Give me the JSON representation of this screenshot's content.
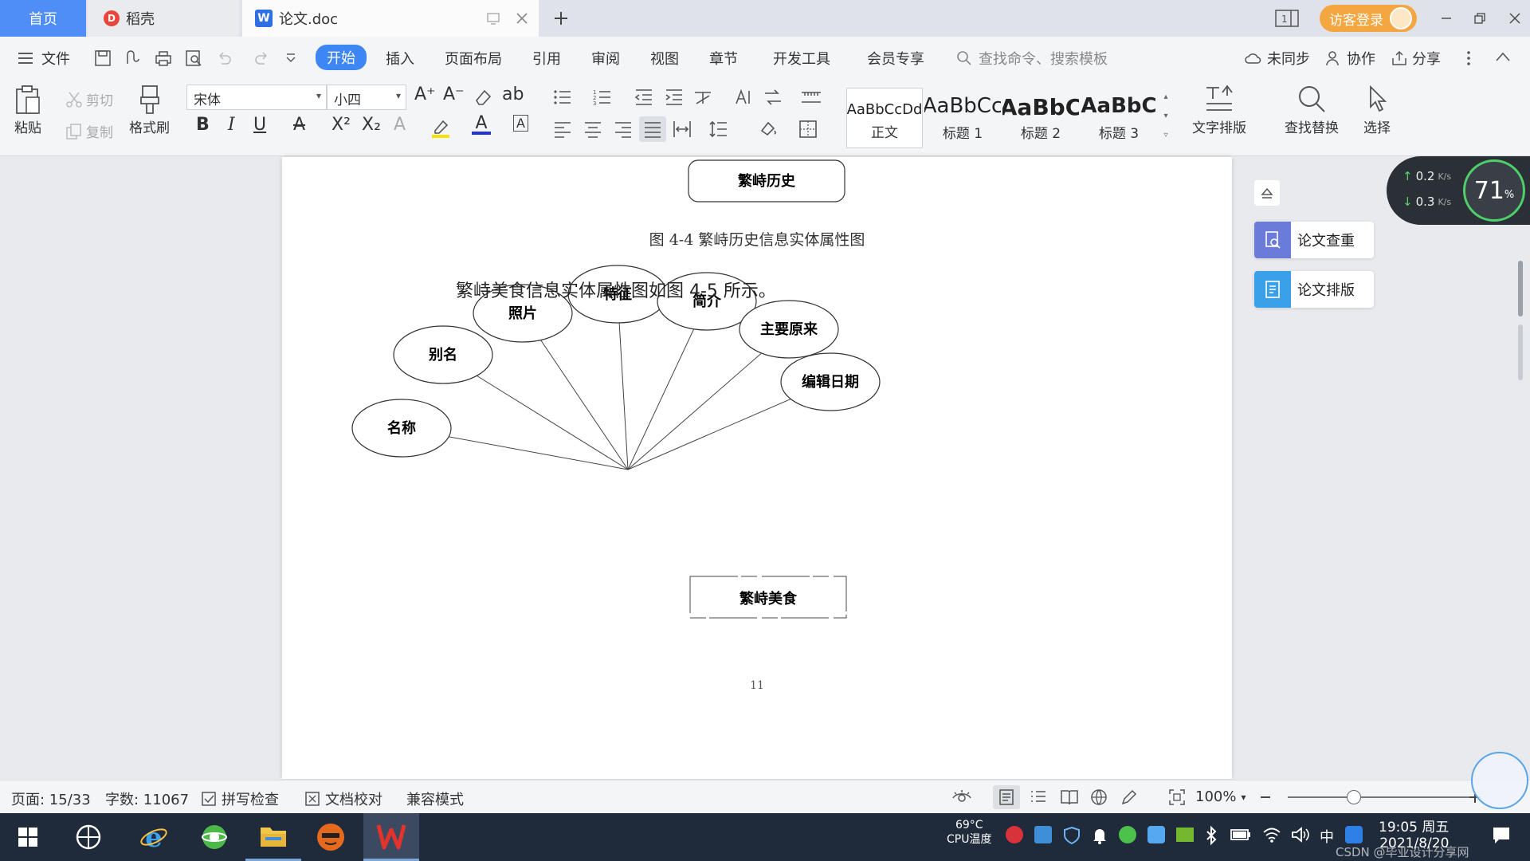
{
  "tabs": {
    "home": "首页",
    "daoke": "稻壳",
    "doc": "论文.doc",
    "daoke_icon_letter": "D",
    "doc_icon_letter": "W"
  },
  "titlebar": {
    "login": "访客登录"
  },
  "menu": {
    "file": "文件",
    "items": [
      "开始",
      "插入",
      "页面布局",
      "引用",
      "审阅",
      "视图",
      "章节",
      "开发工具",
      "会员专享"
    ],
    "search_placeholder": "查找命令、搜索模板",
    "sync": "未同步",
    "collab": "协作",
    "share": "分享"
  },
  "ribbon": {
    "paste": "粘贴",
    "cut": "剪切",
    "copy": "复制",
    "format_painter": "格式刷",
    "font_name": "宋体",
    "font_size": "小四",
    "styles": [
      {
        "sample": "AaBbCcDd",
        "label": "正文"
      },
      {
        "sample": "AaBbCc",
        "label": "标题 1"
      },
      {
        "sample": "AaBbC",
        "label": "标题 2"
      },
      {
        "sample": "AaBbC",
        "label": "标题 3"
      }
    ],
    "text_layout": "文字排版",
    "find_replace": "查找替换",
    "select": "选择"
  },
  "document": {
    "prev_entity": "繁峙历史",
    "prev_caption": "图 4-4 繁峙历史信息实体属性图",
    "paragraph": "繁峙美食信息实体属性图如图 4-5 所示。",
    "entity": "繁峙美食",
    "attributes": [
      "名称",
      "别名",
      "照片",
      "特征",
      "简介",
      "主要原来",
      "编辑日期"
    ],
    "page_number": "11"
  },
  "side_panel": {
    "check": "论文查重",
    "layout": "论文排版"
  },
  "net_widget": {
    "up": "0.2",
    "down": "0.3",
    "unit": "K/s",
    "percent": "71",
    "percent_sign": "%"
  },
  "status": {
    "page": "页面: 15/33",
    "words": "字数: 11067",
    "spell": "拼写检查",
    "proof": "文档校对",
    "compat": "兼容模式",
    "zoom": "100%",
    "zoom_level": 1.0
  },
  "taskbar": {
    "temp": "69°C",
    "temp_label": "CPU温度",
    "ime": "中",
    "time": "19:05 周五",
    "date": "2021/8/20",
    "watermark": "CSDN @毕业设计分享网"
  },
  "colors": {
    "accent": "#3f86f5",
    "login": "#f4a640",
    "side_check": "#6a7bd8",
    "side_layout": "#3aa0e8"
  }
}
